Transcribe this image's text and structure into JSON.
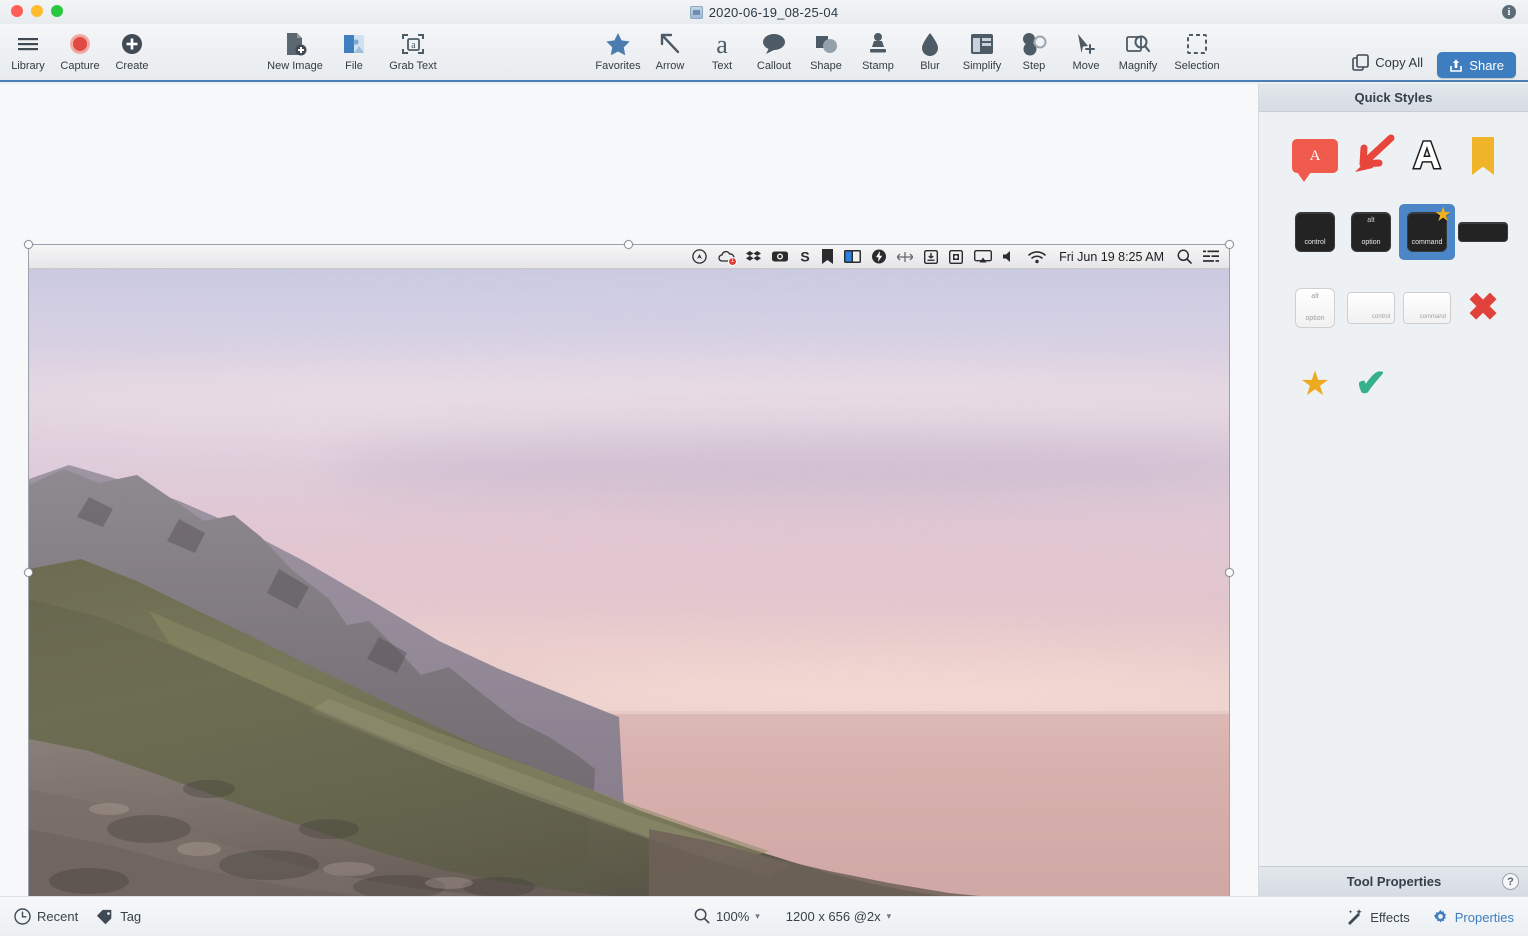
{
  "window": {
    "title": "2020-06-19_08-25-04",
    "title_icon": "image-file-icon",
    "info_icon": "info-icon",
    "traffic_lights": [
      "close",
      "minimize",
      "zoom"
    ]
  },
  "toolbar": {
    "left_group": [
      {
        "label": "Library",
        "icon": "hamburger-icon"
      },
      {
        "label": "Capture",
        "icon": "record-circle-icon"
      },
      {
        "label": "Create",
        "icon": "plus-circle-icon"
      }
    ],
    "mid_group": [
      {
        "label": "New Image",
        "icon": "new-image-icon"
      },
      {
        "label": "File",
        "icon": "file-icon"
      },
      {
        "label": "Grab Text",
        "icon": "grab-text-icon"
      }
    ],
    "tools": [
      {
        "label": "Favorites",
        "icon": "star-icon"
      },
      {
        "label": "Arrow",
        "icon": "arrow-icon"
      },
      {
        "label": "Text",
        "icon": "text-a-icon"
      },
      {
        "label": "Callout",
        "icon": "callout-bubble-icon"
      },
      {
        "label": "Shape",
        "icon": "shape-icon"
      },
      {
        "label": "Stamp",
        "icon": "stamp-icon"
      },
      {
        "label": "Blur",
        "icon": "blur-drop-icon"
      },
      {
        "label": "Simplify",
        "icon": "simplify-icon"
      },
      {
        "label": "Step",
        "icon": "step-icon"
      },
      {
        "label": "Move",
        "icon": "move-cursor-icon"
      },
      {
        "label": "Magnify",
        "icon": "magnify-icon"
      },
      {
        "label": "Selection",
        "icon": "selection-marquee-icon"
      }
    ],
    "copy_all": {
      "label": "Copy All",
      "icon": "copy-icon"
    },
    "share": {
      "label": "Share",
      "icon": "share-upload-icon",
      "color": "#3d7dc0"
    }
  },
  "canvas": {
    "embedded_screenshot": {
      "menubar": {
        "status_icons": [
          "compass-icon",
          "cloud-alert-icon",
          "dropbox-icon",
          "camera-icon",
          "letter-s-icon",
          "bookmark-icon",
          "split-panel-icon",
          "lightning-bolt-icon",
          "move-arrows-icon",
          "download-box-icon",
          "grid-box-icon",
          "airplay-icon",
          "volume-icon",
          "wifi-icon"
        ],
        "cloud_badge": "1",
        "clock": "Fri Jun 19  8:25 AM",
        "search_icon": "search-icon",
        "control_center_icon": "control-center-icon"
      },
      "photo_description": "Coastal mountain hillside at dusk with pink and lavender sky over ocean"
    }
  },
  "quick_styles": {
    "header": "Quick Styles",
    "items": [
      {
        "name": "callout-red-a",
        "kind": "callout",
        "text": "A",
        "color": "#ef5a4c",
        "selected": false
      },
      {
        "name": "arrow-red",
        "kind": "arrow",
        "color": "#e8453c",
        "selected": false
      },
      {
        "name": "text-outline-a",
        "kind": "text",
        "text": "A",
        "selected": false
      },
      {
        "name": "stamp-bookmark-yellow",
        "kind": "bookmark",
        "color": "#f0b429",
        "selected": false
      },
      {
        "name": "key-control-dark",
        "kind": "key-dark",
        "label": "control",
        "top": "",
        "selected": false
      },
      {
        "name": "key-option-dark",
        "kind": "key-dark",
        "label": "option",
        "top": "alt",
        "selected": false
      },
      {
        "name": "key-command-dark",
        "kind": "key-dark",
        "label": "command",
        "top": "",
        "selected": true
      },
      {
        "name": "key-wide-dark",
        "kind": "key-dark-wide",
        "label": "",
        "selected": false
      },
      {
        "name": "key-option-light",
        "kind": "key-light",
        "label": "option",
        "top": "alt",
        "selected": false
      },
      {
        "name": "key-control-light",
        "kind": "key-light",
        "label": "control",
        "top": "",
        "selected": false
      },
      {
        "name": "key-command-light",
        "kind": "key-light",
        "label": "command",
        "top": "",
        "selected": false
      },
      {
        "name": "stamp-x-red",
        "kind": "glyph-x",
        "text": "✖",
        "color": "#e2423c",
        "selected": false
      },
      {
        "name": "stamp-star-yellow",
        "kind": "glyph-star",
        "text": "★",
        "color": "#eda91f",
        "selected": false
      },
      {
        "name": "stamp-check-green",
        "kind": "glyph-check",
        "text": "✔",
        "color": "#35b08a",
        "selected": false
      }
    ]
  },
  "tool_properties": {
    "header": "Tool Properties",
    "help_label": "?"
  },
  "statusbar": {
    "recent": {
      "label": "Recent",
      "icon": "clock-icon"
    },
    "tag": {
      "label": "Tag",
      "icon": "tag-icon"
    },
    "zoom": {
      "label": "100%",
      "icon": "magnifier-icon",
      "caret": "▾"
    },
    "dimensions": {
      "label": "1200 x 656 @2x",
      "caret": "▾"
    },
    "effects": {
      "label": "Effects",
      "icon": "magic-wand-icon"
    },
    "properties": {
      "label": "Properties",
      "icon": "gear-icon",
      "color": "#3d7dc0"
    }
  }
}
